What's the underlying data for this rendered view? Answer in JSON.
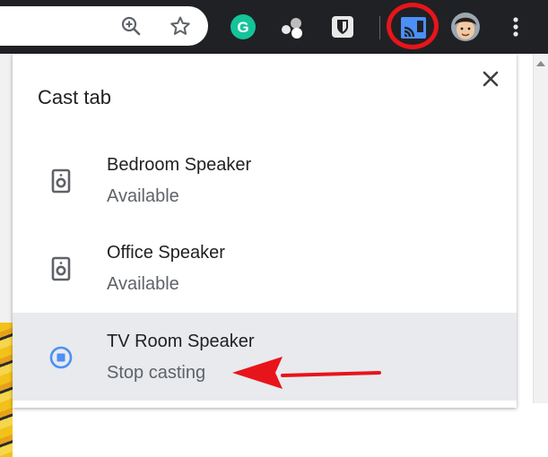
{
  "toolbar": {
    "icons": [
      "zoom-icon",
      "star-icon",
      "grammarly-icon",
      "extension-icon",
      "bitwarden-icon",
      "cast-icon",
      "avatar",
      "more-menu-icon"
    ],
    "grammarly_letter": "G"
  },
  "popup": {
    "title": "Cast tab",
    "close_label": "✕",
    "devices": [
      {
        "name": "Bedroom Speaker",
        "status": "Available",
        "icon": "speaker-icon",
        "active": false
      },
      {
        "name": "Office Speaker",
        "status": "Available",
        "icon": "speaker-icon",
        "active": false
      },
      {
        "name": "TV Room Speaker",
        "status": "Stop casting",
        "icon": "stop-casting-icon",
        "active": true
      }
    ]
  },
  "colors": {
    "toolbar_bg": "#202124",
    "cast_accent": "#4b8ff7",
    "grammarly_green": "#15c39a",
    "annotation_red": "#e8141b",
    "active_row": "#e8eaed"
  }
}
